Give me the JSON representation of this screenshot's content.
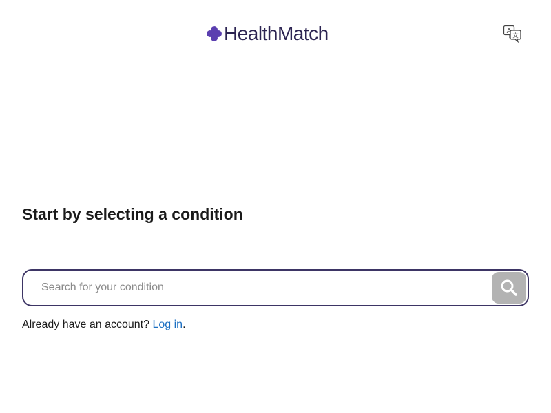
{
  "header": {
    "logo_text": "HealthMatch",
    "logo_icon": "plus-flower-icon",
    "language_icon": "translate-icon",
    "brand_color": "#5b3fb0",
    "logo_text_color": "#2c2452"
  },
  "main": {
    "heading": "Start by selecting a condition",
    "search": {
      "placeholder": "Search for your condition",
      "value": "",
      "button_icon": "search-icon",
      "button_color": "#b3b3b3",
      "border_color": "#3d3565"
    },
    "account": {
      "prompt": "Already have an account?",
      "login_label": "Log in",
      "suffix": ".",
      "link_color": "#1b6fc2"
    }
  }
}
